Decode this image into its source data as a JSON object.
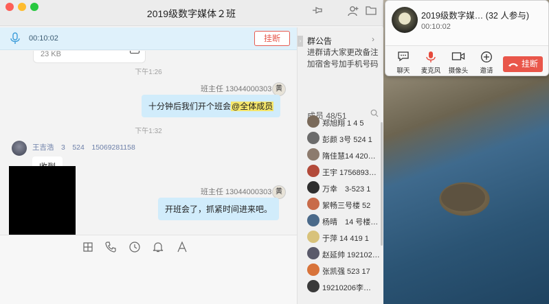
{
  "window": {
    "title": "2019级数字媒体２班"
  },
  "callbar": {
    "time": "00:10:02",
    "hangup_label": "挂断"
  },
  "messages": {
    "file_size": "23 KB",
    "ts1": "下午1:26",
    "sender1": "班主任 13044000303",
    "msg1_text": "十分钟后我们开个班会",
    "msg1_mention": "@全体成员",
    "avatar_char": "黄",
    "ts2": "下午1:32",
    "other_name": "王吉浩　3　524　15069281158",
    "other_msg": "收到",
    "sender2": "班主任 13044000303",
    "msg2_text": "开班会了，抓紧时间进来吧。"
  },
  "side": {
    "notice_title": "群公告",
    "notice_body": "进群请大家更改备注加宿舍号加手机号码",
    "members_label": "成员 48/51",
    "members": [
      {
        "name": "郑旭翔 1 4 5",
        "color": "#7a6a5a"
      },
      {
        "name": "彭颜 3号 524 1",
        "color": "#6b6b6b"
      },
      {
        "name": "隋佳慧14 420…",
        "color": "#8c7b6e"
      },
      {
        "name": "王宇 1756893…",
        "color": "#b34a3a"
      },
      {
        "name": "万幸　3-523 1",
        "color": "#2e2e2e"
      },
      {
        "name": "絮畅三号楼 52",
        "color": "#c86b4a"
      },
      {
        "name": "杨晴　14 号楼…",
        "color": "#4b6a8a"
      },
      {
        "name": "于萍 14 419 1",
        "color": "#d8c27a"
      },
      {
        "name": "赵延帅 192102…",
        "color": "#5a5a6a"
      },
      {
        "name": "张凯强 523 17",
        "color": "#d8733a"
      },
      {
        "name": "19210206李…",
        "color": "#3a3a3a"
      }
    ]
  },
  "call_panel": {
    "title": "2019级数字媒… (32 人参与)",
    "time": "00:10:02",
    "controls": [
      "聊天",
      "麦克风",
      "摄像头",
      "邀请"
    ],
    "hangup_label": "挂断",
    "hangup_color": "#e9564a",
    "mic_color": "#e64a3c"
  }
}
